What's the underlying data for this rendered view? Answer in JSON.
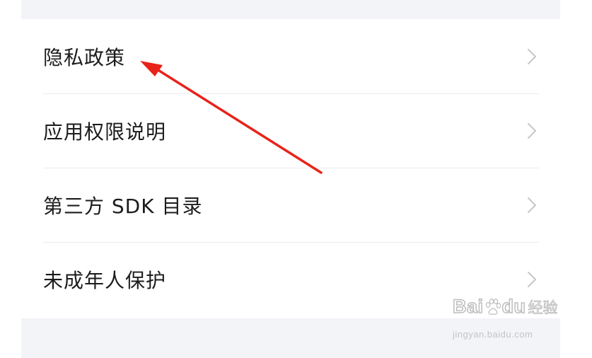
{
  "settings_list": {
    "items": [
      {
        "label": "隐私政策"
      },
      {
        "label": "应用权限说明"
      },
      {
        "label": "第三方 SDK 目录"
      },
      {
        "label": "未成年人保护"
      }
    ]
  },
  "annotation": {
    "arrow_color": "#e8231a"
  },
  "watermark": {
    "logo_left": "Bai",
    "logo_right": "du",
    "chinese": "经验",
    "url": "jingyan.baidu.com"
  },
  "colors": {
    "background": "#ffffff",
    "panel_gray": "#f3f4f8",
    "divider": "#ececec",
    "text": "#1c1c1e",
    "chevron": "#c7c7cc"
  }
}
